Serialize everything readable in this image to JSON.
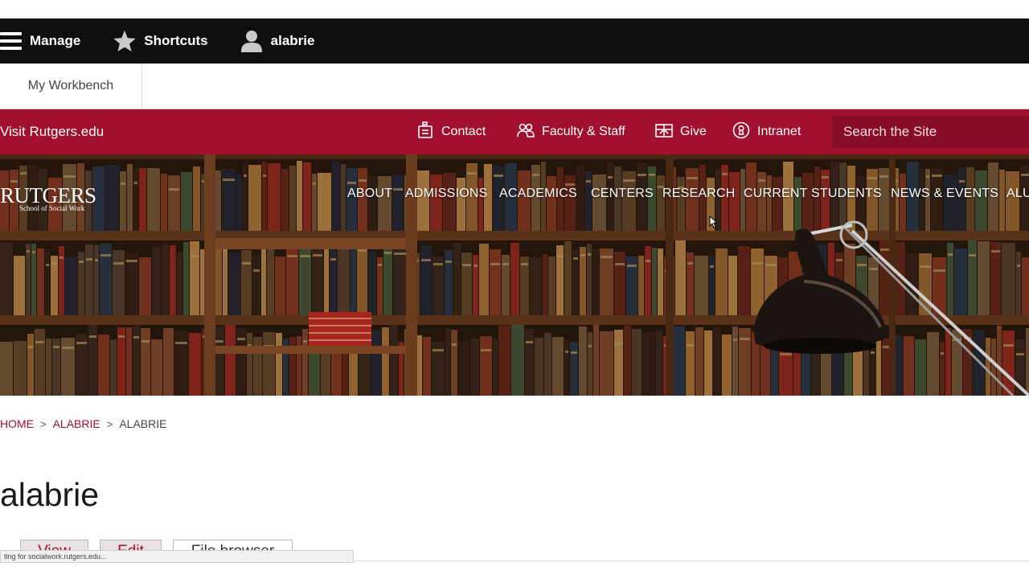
{
  "admin_toolbar": {
    "manage_label": "Manage",
    "shortcuts_label": "Shortcuts",
    "user_label": "alabrie",
    "background": "#0f0f0f"
  },
  "tray": {
    "workbench_label": "My Workbench"
  },
  "utility_bar": {
    "background": "#a1102e",
    "visit_label": "Visit Rutgers.edu",
    "links": [
      {
        "label": "Contact",
        "icon": "mailbox-icon"
      },
      {
        "label": "Faculty & Staff",
        "icon": "people-icon"
      },
      {
        "label": "Give",
        "icon": "gift-icon"
      },
      {
        "label": "Intranet",
        "icon": "keyhole-icon"
      }
    ],
    "search_placeholder": "Search the Site"
  },
  "header": {
    "logo_main": "RUTGERS",
    "logo_sub": "School of Social Work",
    "nav": [
      "ABOUT",
      "ADMISSIONS",
      "ACADEMICS",
      "CENTERS",
      "RESEARCH",
      "CURRENT STUDENTS",
      "NEWS & EVENTS",
      "ALU"
    ]
  },
  "breadcrumb": {
    "home": "HOME",
    "parent": "ALABRIE",
    "current": "ALABRIE"
  },
  "page": {
    "title": "alabrie",
    "tabs": [
      "View",
      "Edit",
      "File browser"
    ]
  },
  "status_bar": {
    "text": "ting for socialwork.rutgers.edu..."
  }
}
